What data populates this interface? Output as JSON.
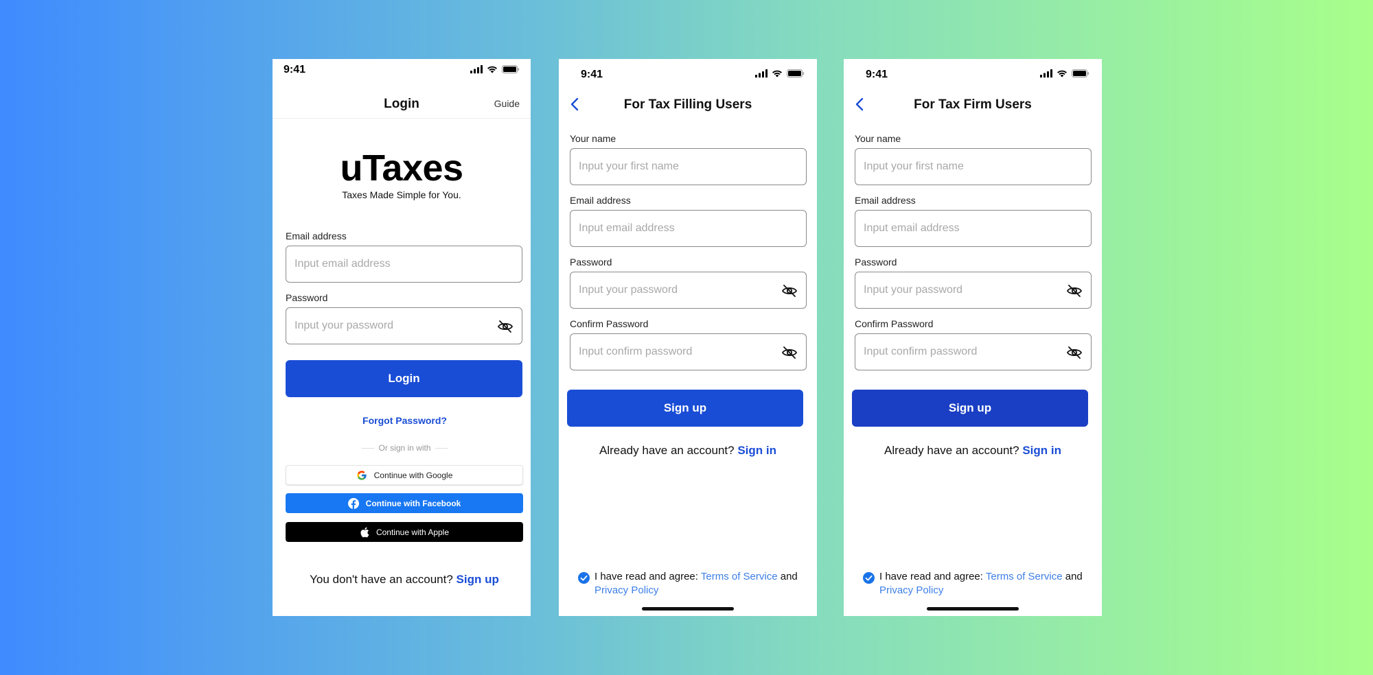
{
  "status_time": "9:41",
  "login": {
    "nav_title": "Login",
    "guide": "Guide",
    "brand_name": "uTaxes",
    "brand_tagline": "Taxes Made Simple for You.",
    "email_label": "Email address",
    "email_placeholder": "Input email address",
    "password_label": "Password",
    "password_placeholder": "Input your password",
    "login_button": "Login",
    "forgot_password": "Forgot Password?",
    "or_sign_in_with": "Or sign in with",
    "google_button": "Continue with Google",
    "facebook_button": "Continue with Facebook",
    "apple_button": "Continue with Apple",
    "no_account_text": "You don't have an account?",
    "sign_up_link": "Sign up"
  },
  "filing": {
    "nav_title": "For Tax Filling Users",
    "name_label": "Your name",
    "name_placeholder": "Input your first name",
    "email_label": "Email address",
    "email_placeholder": "Input email address",
    "password_label": "Password",
    "password_placeholder": "Input your password",
    "confirm_label": "Confirm Password",
    "confirm_placeholder": "Input confirm password",
    "signup_button": "Sign up",
    "have_account_text": "Already have an account?",
    "sign_in_link": "Sign in",
    "agree_text": "I have read and agree:",
    "terms_link": "Terms of Service",
    "and_text": "and",
    "privacy_link": "Privacy Policy"
  },
  "firm": {
    "nav_title": "For Tax Firm Users",
    "name_label": "Your name",
    "name_placeholder": "Input your first name",
    "email_label": "Email address",
    "email_placeholder": "Input email address",
    "password_label": "Password",
    "password_placeholder": "Input your password",
    "confirm_label": "Confirm Password",
    "confirm_placeholder": "Input confirm password",
    "signup_button": "Sign up",
    "have_account_text": "Already have an account?",
    "sign_in_link": "Sign in",
    "agree_text": "I have read and agree:",
    "terms_link": "Terms of Service",
    "and_text": "and",
    "privacy_link": "Privacy Policy"
  },
  "colors": {
    "primary": "#1a4dd6",
    "facebook": "#1877f2",
    "link": "#3d7fe6"
  },
  "icons": [
    "signal-icon",
    "wifi-icon",
    "battery-icon",
    "eye-off-icon",
    "back-chevron-icon",
    "google-icon",
    "facebook-icon",
    "apple-icon",
    "check-icon"
  ]
}
